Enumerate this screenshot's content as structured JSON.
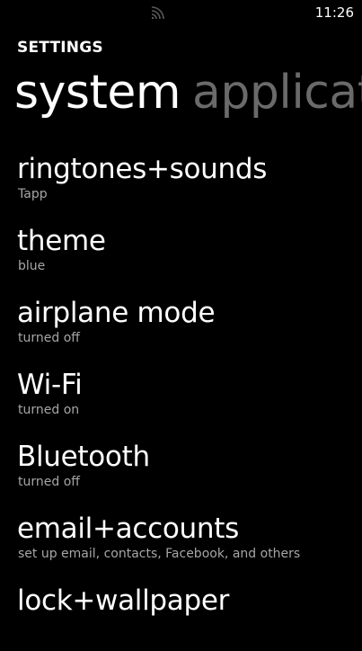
{
  "status_bar": {
    "time": "11:26",
    "signal_icon": "wifi-signal-icon"
  },
  "app": {
    "title": "SETTINGS"
  },
  "pivot": {
    "headers": [
      {
        "label": "system",
        "active": true
      },
      {
        "label": "applicat",
        "active": false
      }
    ]
  },
  "settings_list": [
    {
      "title": "ringtones+sounds",
      "subtitle": "Tapp"
    },
    {
      "title": "theme",
      "subtitle": "blue"
    },
    {
      "title": "airplane mode",
      "subtitle": "turned off"
    },
    {
      "title": "Wi-Fi",
      "subtitle": "turned on"
    },
    {
      "title": "Bluetooth",
      "subtitle": "turned off"
    },
    {
      "title": "email+accounts",
      "subtitle": "set up email, contacts, Facebook, and others"
    },
    {
      "title": "lock+wallpaper",
      "subtitle": ""
    }
  ],
  "colors": {
    "background": "#000000",
    "foreground": "#ffffff",
    "subtle": "#a6a6a6",
    "inactive_pivot": "#6a6a6a"
  }
}
